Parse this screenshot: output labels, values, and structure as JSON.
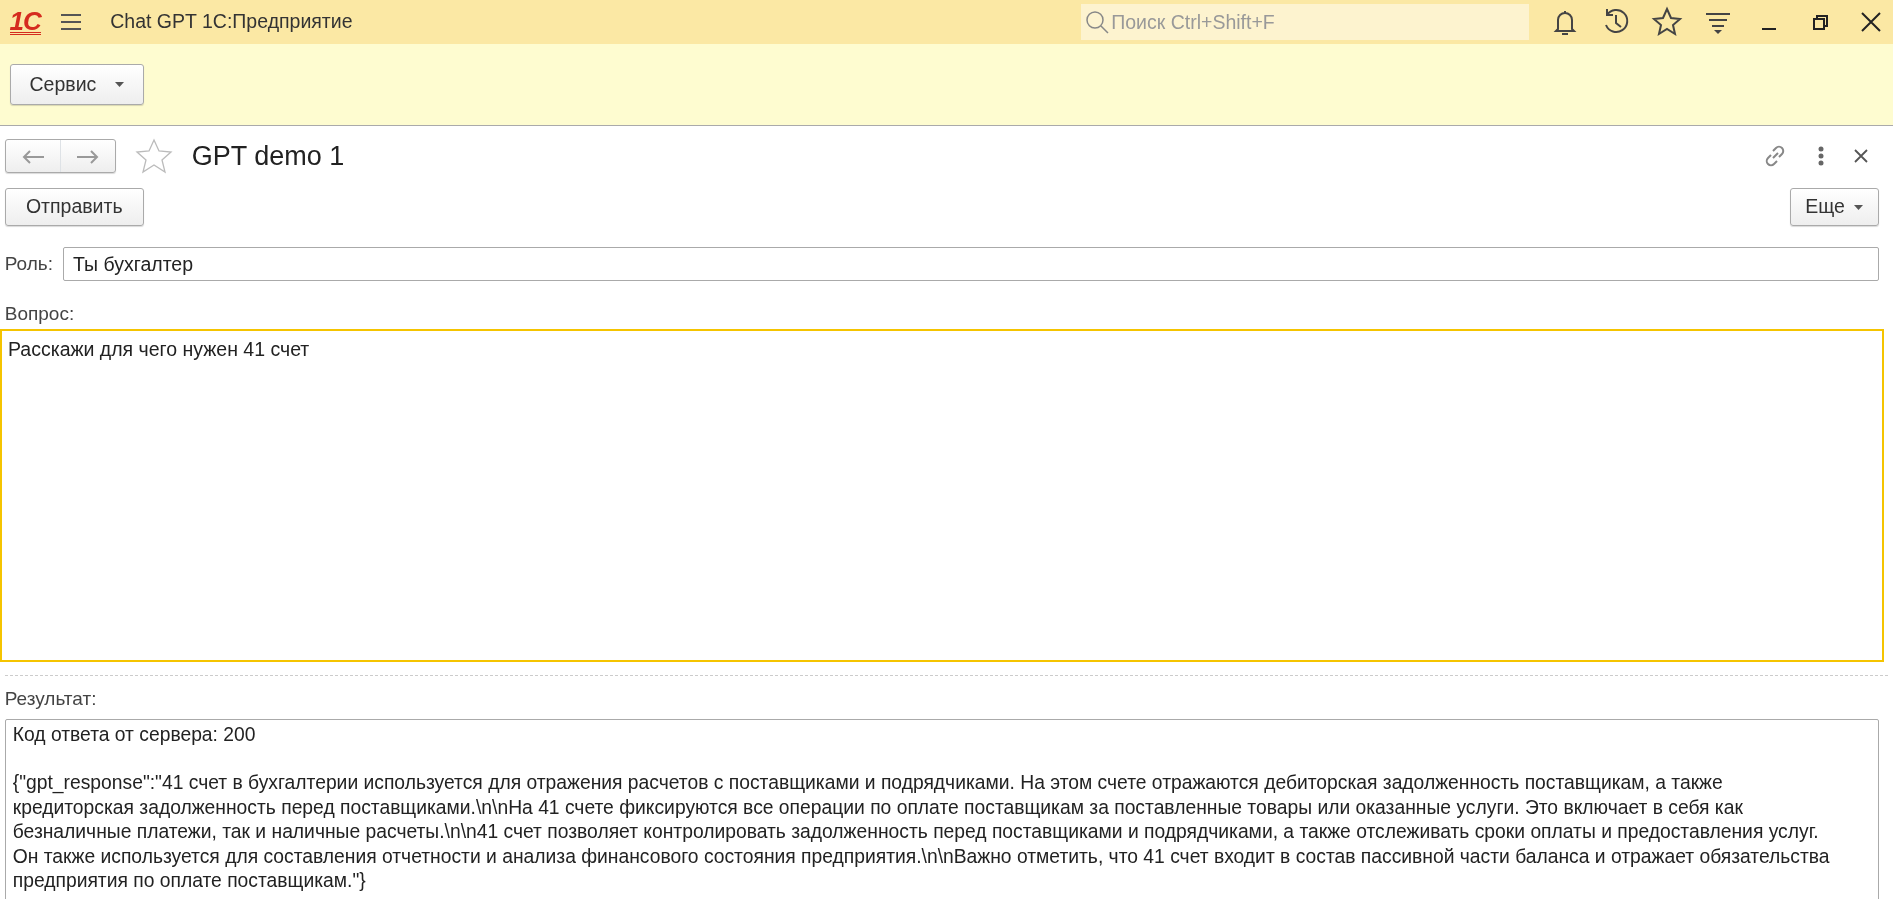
{
  "window": {
    "logo": "1С",
    "title": "Chat GPT 1С:Предприятие",
    "search": {
      "placeholder": "Поиск Ctrl+Shift+F"
    }
  },
  "toolbar": {
    "menu_button": "Сервис"
  },
  "form": {
    "title": "GPT demo 1",
    "favorite": false,
    "send_button": "Отправить",
    "more_button": "Еще"
  },
  "fields": {
    "role": {
      "label": "Роль:",
      "value": "Ты бухгалтер"
    },
    "question": {
      "label": "Вопрос:",
      "value": "Расскажи для чего нужен 41 счет",
      "focused": true
    },
    "result": {
      "label": "Результат:",
      "status_line": "Код ответа от сервера: 200",
      "response_lines": [
        "{\"gpt_response\":\"41 счет в бухгалтерии используется для отражения расчетов с поставщиками и подрядчиками. На этом счете отражаются дебиторская задолженность поставщикам, а также",
        "кредиторская задолженность перед поставщиками.\\n\\nНа 41 счете фиксируются все операции по оплате поставщикам за поставленные товары или оказанные услуги. Это включает в себя как",
        "безналичные платежи, так и наличные расчеты.\\n\\n41 счет позволяет контролировать задолженность перед поставщиками и подрядчиками, а также отслеживать сроки оплаты и предоставления услуг.",
        "Он также используется для составления отчетности и анализа финансового состояния предприятия.\\n\\nВажно отметить, что 41 счет входит в состав пассивной части баланса и отражает обязательства",
        "предприятия по оплате поставщикам.\"}"
      ]
    }
  }
}
